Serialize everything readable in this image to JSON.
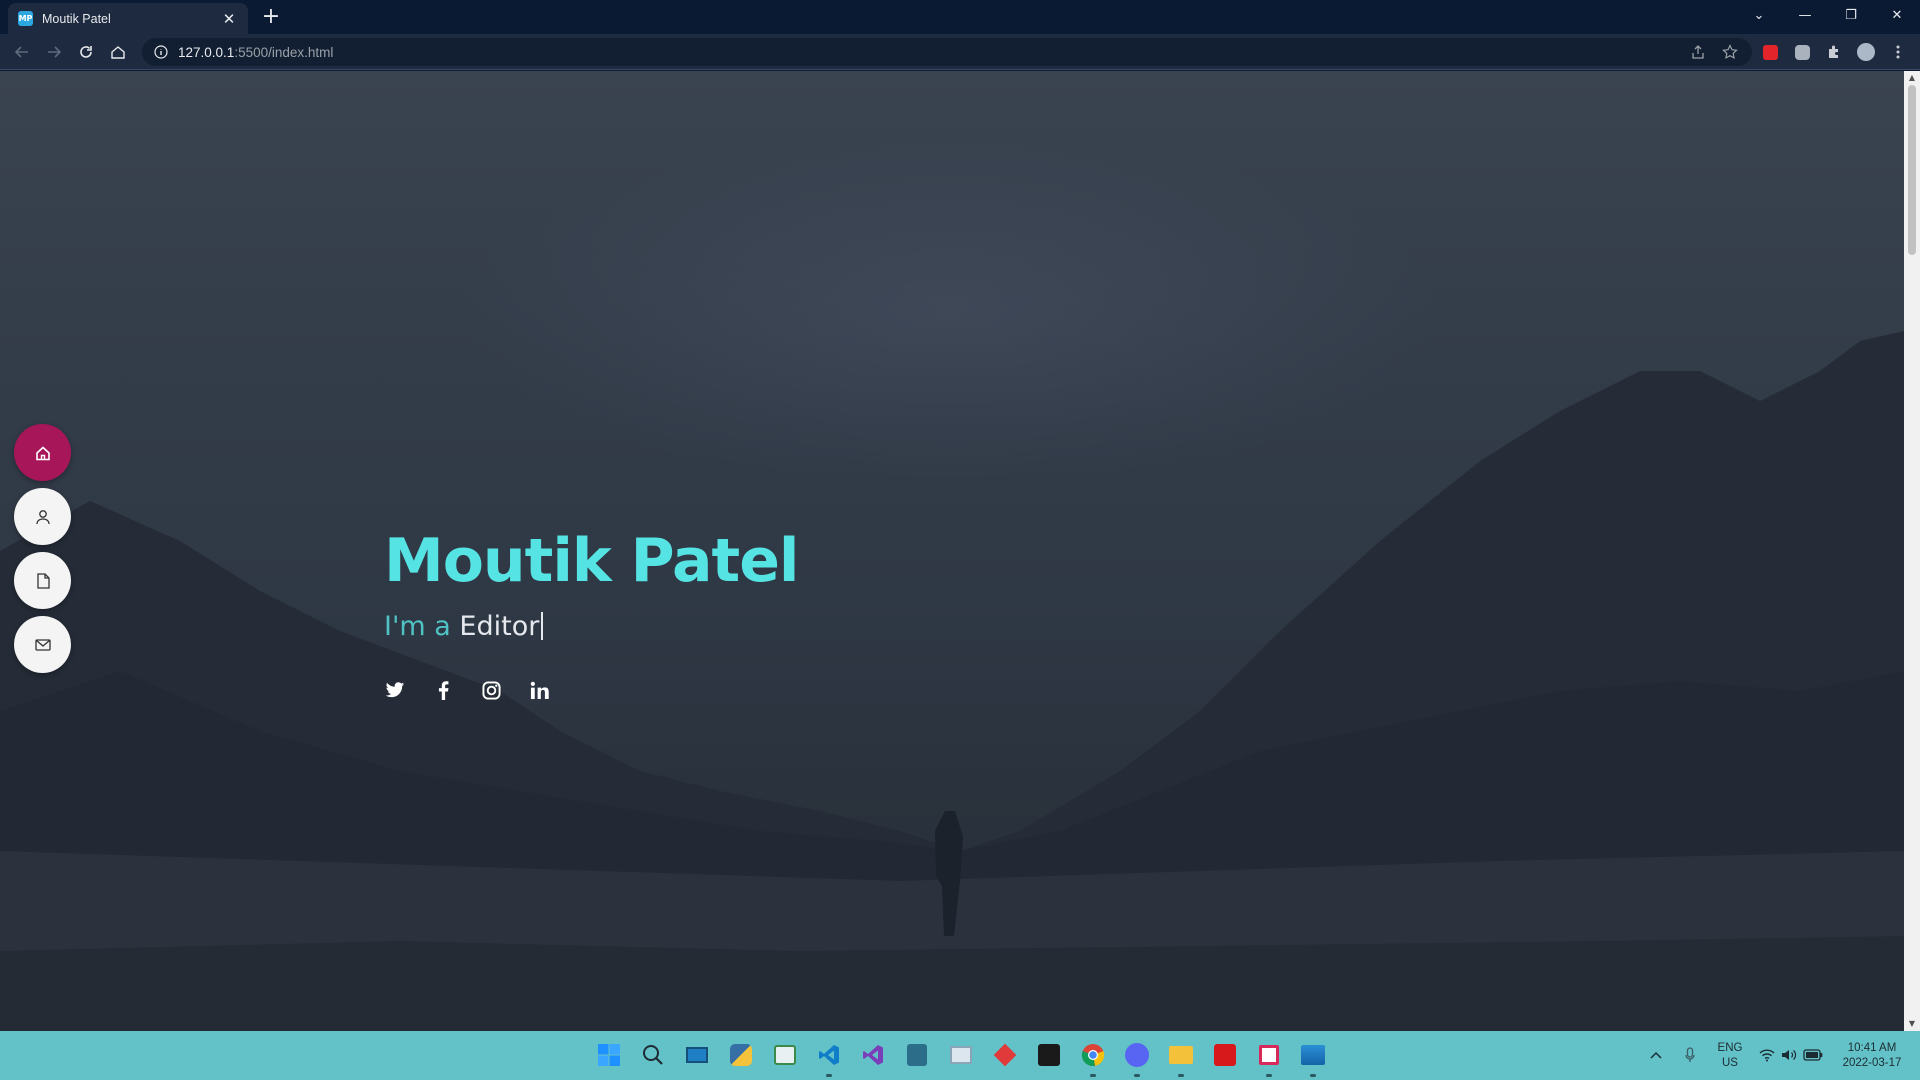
{
  "browser": {
    "tab_title": "Moutik Patel",
    "favicon_text": "MP",
    "url_host": "127.0.0.1",
    "url_path": ":5500/index.html"
  },
  "page": {
    "name": "Moutik Patel",
    "subtitle_prefix": "I'm a",
    "subtitle_role": "Editor",
    "nav": [
      {
        "name": "home-icon",
        "active": true
      },
      {
        "name": "user-icon",
        "active": false
      },
      {
        "name": "document-icon",
        "active": false
      },
      {
        "name": "mail-icon",
        "active": false
      }
    ],
    "social": [
      "twitter-icon",
      "facebook-icon",
      "instagram-icon",
      "linkedin-icon"
    ],
    "colors": {
      "accent": "#56e3e3",
      "active_nav": "#a8165a"
    }
  },
  "taskbar": {
    "language": "ENG",
    "region": "US",
    "time": "10:41 AM",
    "date": "2022-03-17"
  }
}
